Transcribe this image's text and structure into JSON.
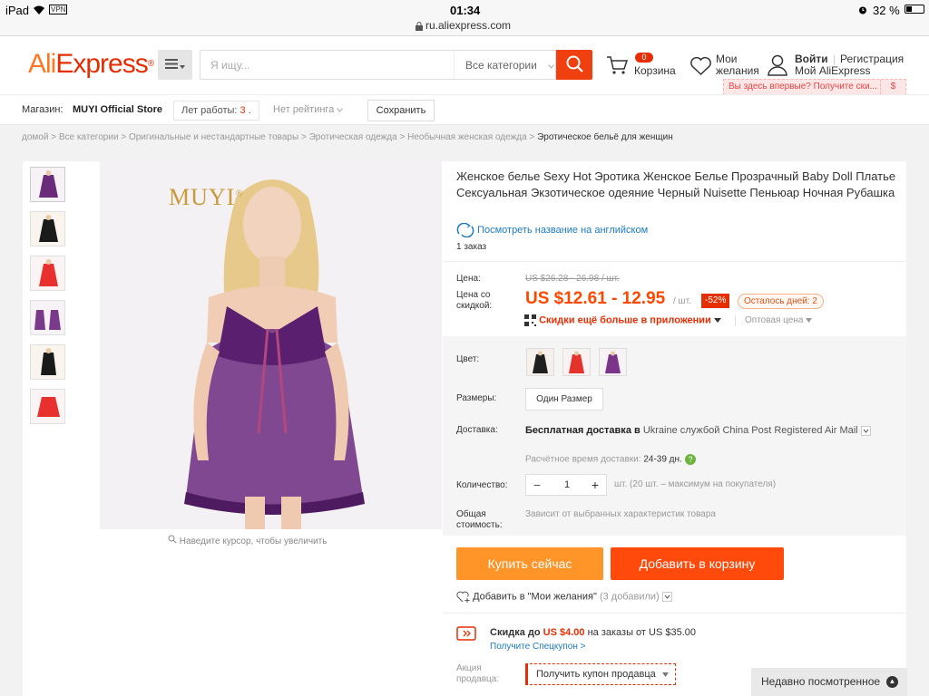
{
  "status": {
    "device": "iPad",
    "vpn": "VPN",
    "time": "01:34",
    "url": "ru.aliexpress.com",
    "battery": "32 %"
  },
  "header": {
    "logo_part1": "Ali",
    "logo_part2": "Express",
    "logo_reg": "®",
    "search_placeholder": "Я ищу...",
    "category_select": "Все категории",
    "cart_count": "0",
    "cart_label": "Корзина",
    "wishlist_label_1": "Мои",
    "wishlist_label_2": "желания",
    "signin": "Войти",
    "register": "Регистрация",
    "my_account": "Мой AliExpress",
    "newbie_text": "Вы здесь впервые? Получите ски...",
    "newbie_dollar": "$"
  },
  "store": {
    "label": "Магазин:",
    "name": "MUYI Official Store",
    "years_label": "Лет работы:",
    "years_value": "3",
    "years_suffix": ".",
    "rating": "Нет рейтинга",
    "save": "Сохранить"
  },
  "breadcrumb": [
    "домой",
    "Все категории",
    "Оригинальные и нестандартные товары",
    "Эротическая одежда",
    "Необычная женская одежда",
    "Эротическое бельё для женщин"
  ],
  "breadcrumb_sep": ">",
  "gallery": {
    "brand": "MUYI",
    "brand_reg": "®",
    "zoom_hint": "Наведите курсор, чтобы увеличить",
    "thumbnails": [
      {
        "color": "#6a2c7a"
      },
      {
        "color": "#1a1a1a"
      },
      {
        "color": "#e8312f"
      },
      {
        "color": "#7a3a8a"
      },
      {
        "color": "#1a1a1a"
      },
      {
        "color": "#e8312f"
      }
    ]
  },
  "product": {
    "title": "Женское белье Sexy Hot Эротика Женское Белье Прозрачный Baby Doll Платье Сексуальная Экзотическое одеяние Черный Nuisette Пеньюар Ночная Рубашка",
    "translate_link": "Посмотреть название на английском",
    "orders": "1 заказ",
    "price_label": "Цена:",
    "price_old": "US $26.28 - 26.98 / шт.",
    "discount_price_label": "Цена со скидкой:",
    "price_new": "US $12.61 - 12.95",
    "per_unit": "/ шт.",
    "discount": "-52%",
    "days_left": "Осталось дней: 2",
    "app_deals": "Скидки ещё больше в приложении",
    "wholesale": "Оптовая цена",
    "color_label": "Цвет:",
    "colors": [
      {
        "name": "black",
        "color": "#1f1f1f"
      },
      {
        "name": "red",
        "color": "#e5322d"
      },
      {
        "name": "purple",
        "color": "#7a358a"
      }
    ],
    "size_label": "Размеры:",
    "size_value": "Один Размер",
    "delivery_label": "Доставка:",
    "delivery_free": "Бесплатная доставка в",
    "delivery_country": "Ukraine",
    "delivery_by": "службой",
    "delivery_service": "China Post Registered Air Mail",
    "eta_label": "Расчётное время доставки:",
    "eta_value": "24-39 дн.",
    "qty_label": "Количество:",
    "qty_value": "1",
    "qty_minus": "−",
    "qty_plus": "+",
    "qty_note": "шт. (20 шт. – максимум на покупателя)",
    "total_label": "Общая стоимость:",
    "total_note": "Зависит от выбранных характеристик товара",
    "buy_now": "Купить сейчас",
    "add_to_cart": "Добавить в корзину",
    "wishlist_add": "Добавить в \"Мои желания\"",
    "wishlist_count": "(3 добавили)",
    "coupon_prefix": "Скидка до",
    "coupon_amount": "US $4.00",
    "coupon_suffix": "на заказы от US $35.00",
    "coupon_link": "Получите Спецкупон >",
    "seller_promo_label": "Акция продавца:",
    "seller_coupon": "Получить купон продавца"
  },
  "recently_viewed": "Недавно посмотренное",
  "colors": {
    "accent": "#ff4700",
    "brand_orange": "#ff7722",
    "brand_red": "#e62e04",
    "link": "#1a7cc5",
    "buy_now": "#ff9428",
    "add_cart": "#ff4a0c"
  }
}
